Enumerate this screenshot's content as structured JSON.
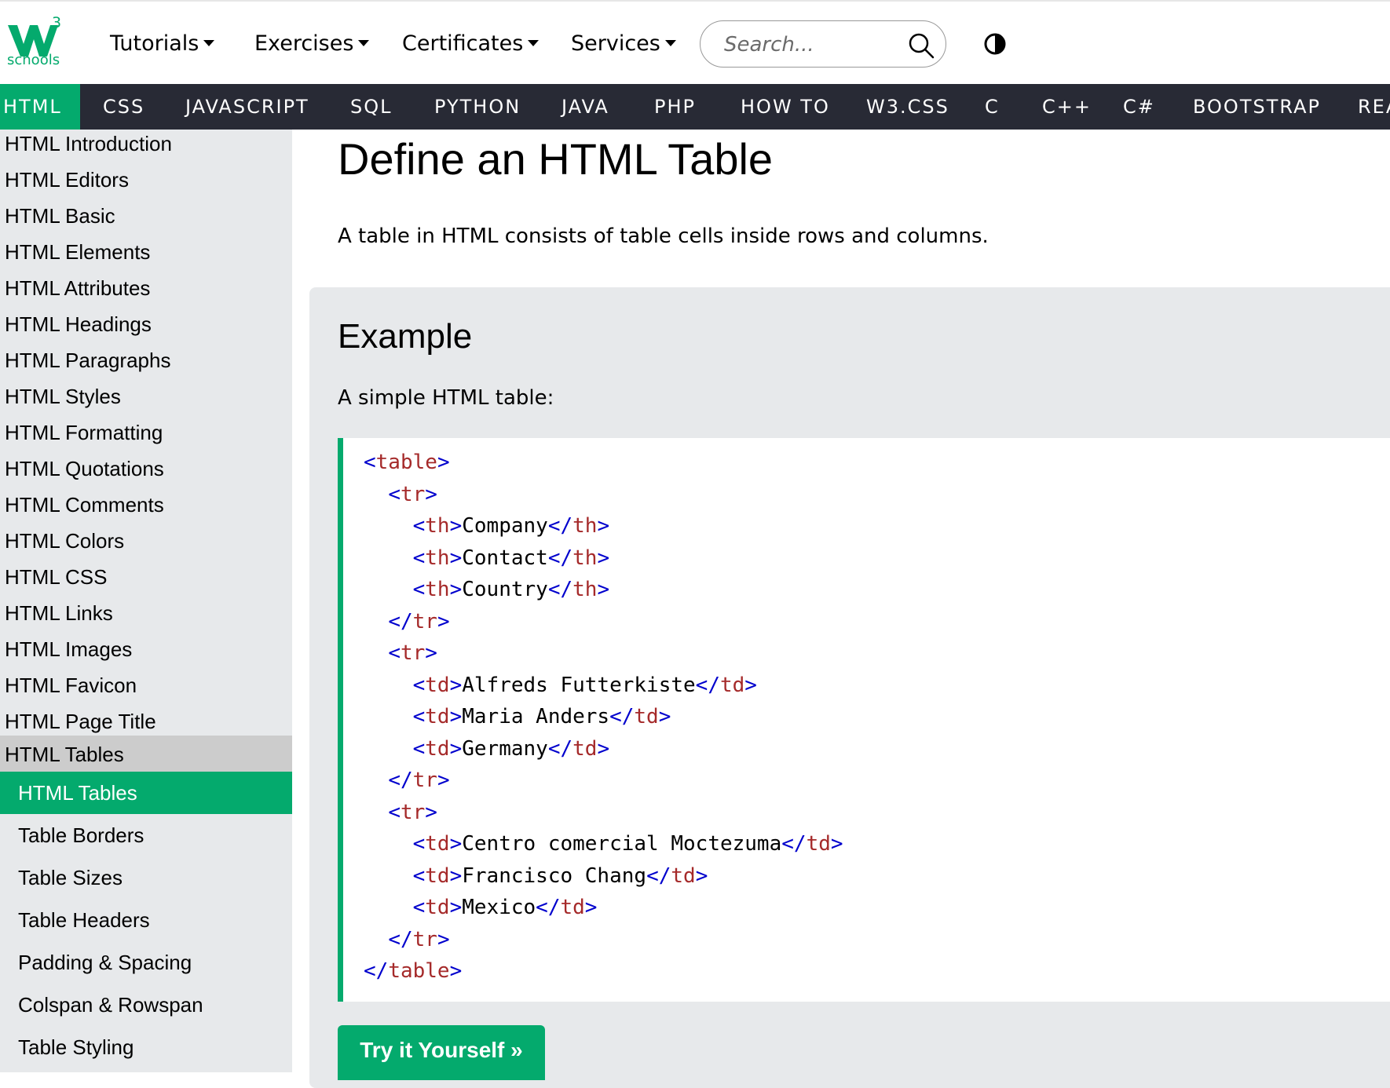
{
  "logo": {
    "main": "W",
    "superscript": "3",
    "text": "schools"
  },
  "topnav": [
    {
      "label": "Tutorials"
    },
    {
      "label": "Exercises"
    },
    {
      "label": "Certificates"
    },
    {
      "label": "Services"
    }
  ],
  "search": {
    "placeholder": "Search..."
  },
  "subjects": [
    "HTML",
    "CSS",
    "JAVASCRIPT",
    "SQL",
    "PYTHON",
    "JAVA",
    "PHP",
    "HOW TO",
    "W3.CSS",
    "C",
    "C++",
    "C#",
    "BOOTSTRAP",
    "REACT"
  ],
  "sidebar": {
    "items": [
      "HTML Introduction",
      "HTML Editors",
      "HTML Basic",
      "HTML Elements",
      "HTML Attributes",
      "HTML Headings",
      "HTML Paragraphs",
      "HTML Styles",
      "HTML Formatting",
      "HTML Quotations",
      "HTML Comments",
      "HTML Colors",
      "HTML CSS",
      "HTML Links",
      "HTML Images",
      "HTML Favicon",
      "HTML Page Title"
    ],
    "group": "HTML Tables",
    "subitems": [
      "HTML Tables",
      "Table Borders",
      "Table Sizes",
      "Table Headers",
      "Padding & Spacing",
      "Colspan & Rowspan",
      "Table Styling"
    ]
  },
  "main": {
    "title": "Define an HTML Table",
    "intro": "A table in HTML consists of table cells inside rows and columns.",
    "example_title": "Example",
    "example_desc": "A simple HTML table:",
    "try_button": "Try it Yourself »"
  },
  "code": [
    {
      "indent": "",
      "kind": "open",
      "tag": "table",
      "text": ""
    },
    {
      "indent": "  ",
      "kind": "open",
      "tag": "tr",
      "text": ""
    },
    {
      "indent": "    ",
      "kind": "pair",
      "tag": "th",
      "text": "Company"
    },
    {
      "indent": "    ",
      "kind": "pair",
      "tag": "th",
      "text": "Contact"
    },
    {
      "indent": "    ",
      "kind": "pair",
      "tag": "th",
      "text": "Country"
    },
    {
      "indent": "  ",
      "kind": "close",
      "tag": "tr",
      "text": ""
    },
    {
      "indent": "  ",
      "kind": "open",
      "tag": "tr",
      "text": ""
    },
    {
      "indent": "    ",
      "kind": "pair",
      "tag": "td",
      "text": "Alfreds Futterkiste"
    },
    {
      "indent": "    ",
      "kind": "pair",
      "tag": "td",
      "text": "Maria Anders"
    },
    {
      "indent": "    ",
      "kind": "pair",
      "tag": "td",
      "text": "Germany"
    },
    {
      "indent": "  ",
      "kind": "close",
      "tag": "tr",
      "text": ""
    },
    {
      "indent": "  ",
      "kind": "open",
      "tag": "tr",
      "text": ""
    },
    {
      "indent": "    ",
      "kind": "pair",
      "tag": "td",
      "text": "Centro comercial Moctezuma"
    },
    {
      "indent": "    ",
      "kind": "pair",
      "tag": "td",
      "text": "Francisco Chang"
    },
    {
      "indent": "    ",
      "kind": "pair",
      "tag": "td",
      "text": "Mexico"
    },
    {
      "indent": "  ",
      "kind": "close",
      "tag": "tr",
      "text": ""
    },
    {
      "indent": "",
      "kind": "close",
      "tag": "table",
      "text": ""
    }
  ],
  "colors": {
    "accent": "#04aa6d",
    "navbar": "#282a35",
    "sidebar": "#e7e9eb",
    "tag_bracket": "#0000cd",
    "tag_name": "#a52a2a"
  },
  "icons": {
    "search": "search-icon",
    "contrast": "contrast-icon"
  }
}
